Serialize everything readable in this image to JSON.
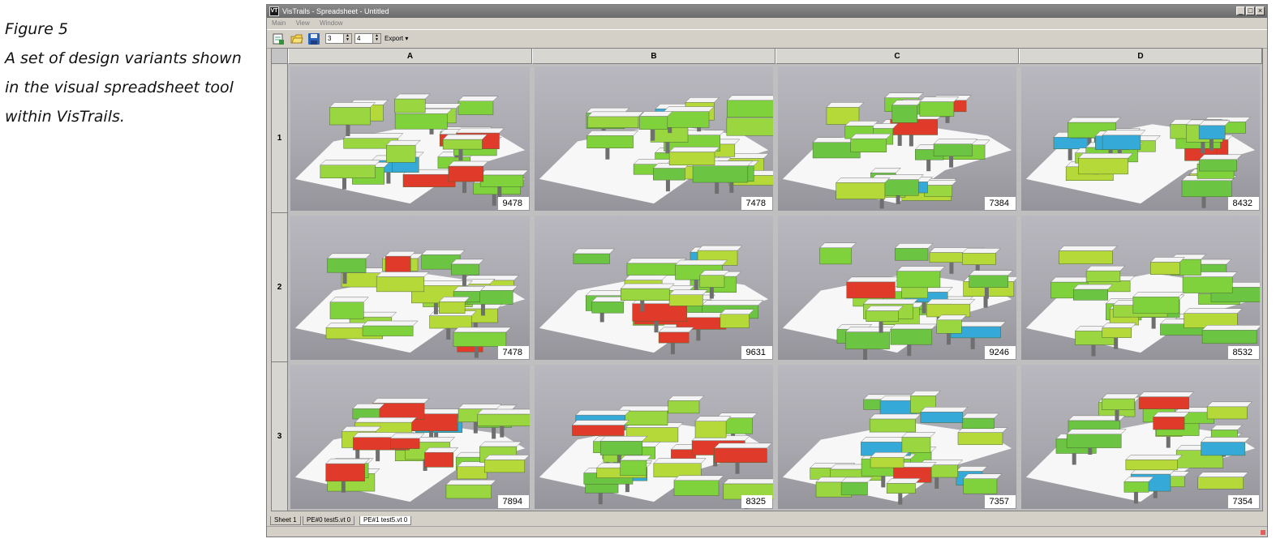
{
  "figure_caption": {
    "label": "Figure 5",
    "text_lines": [
      "A set of design variants shown",
      "in the visual spreadsheet tool",
      "within VisTrails."
    ]
  },
  "window": {
    "title": "VisTrails - Spreadsheet - Untitled",
    "app_icon": "VT",
    "controls": [
      "minimize-icon",
      "maximize-icon",
      "close-icon"
    ]
  },
  "menu": [
    "Main",
    "View",
    "Window"
  ],
  "toolbar": {
    "buttons": [
      "new-sheet-icon",
      "open-folder-icon",
      "save-disk-icon"
    ],
    "row_count": "3",
    "column_count": "4",
    "export_label": "Export"
  },
  "spreadsheet": {
    "columns": [
      "A",
      "B",
      "C",
      "D"
    ],
    "rows": [
      "1",
      "2",
      "3"
    ],
    "cells": [
      [
        "9478",
        "7478",
        "7384",
        "8432"
      ],
      [
        "7478",
        "9631",
        "9246",
        "8532"
      ],
      [
        "7894",
        "8325",
        "7357",
        "7354"
      ]
    ]
  },
  "tabs": [
    {
      "label": "Sheet 1",
      "active": false
    },
    {
      "label": "PE#0 test5.vt 0",
      "active": false
    },
    {
      "label": "PE#1 test5.vt 0",
      "active": true
    }
  ],
  "colors": {
    "window_frame": "#d4d0c8",
    "cell_background": "#b0afb6",
    "building_green": "#7fd23b",
    "building_hot": "#e03a2a",
    "building_cool": "#35a9d8"
  }
}
